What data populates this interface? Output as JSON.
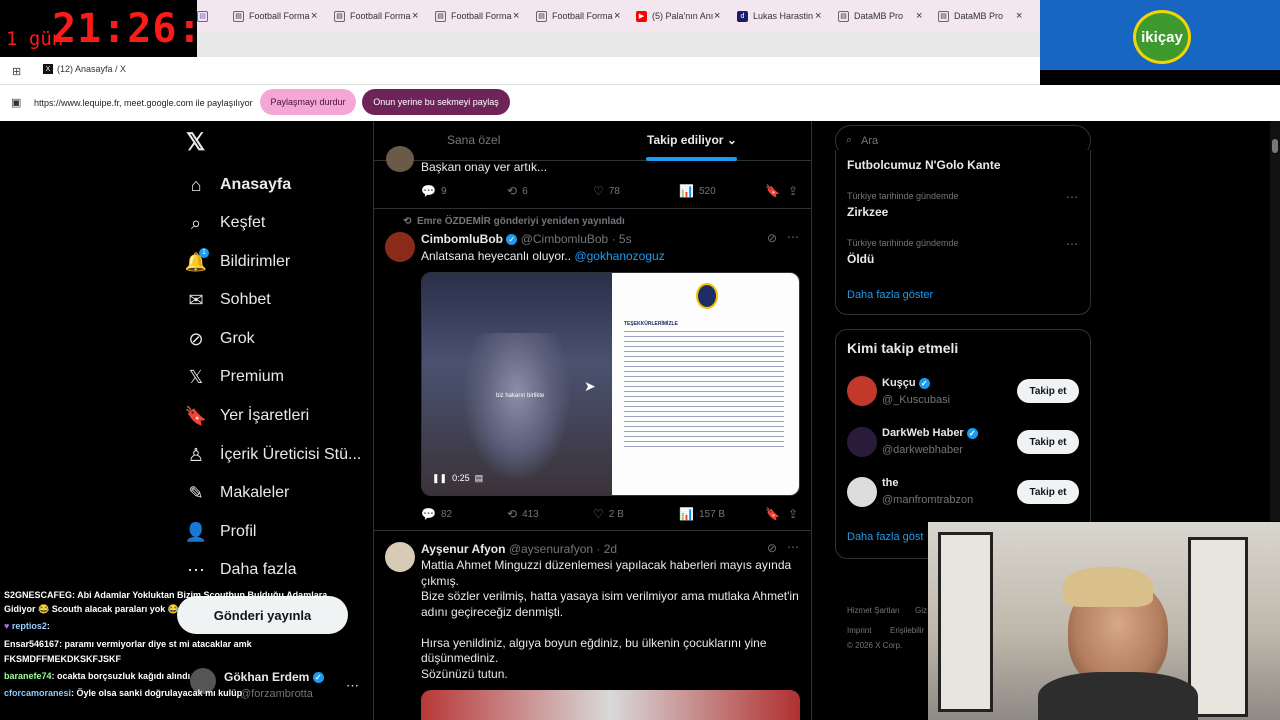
{
  "overlay": {
    "timer_day": "1 gün",
    "timer_clock": "21:26:55",
    "sponsor": "ikiçay"
  },
  "browser": {
    "tabs": [
      {
        "label": "Football Forma",
        "icon": "doc-icon"
      },
      {
        "label": "Football Forma",
        "icon": "doc-icon"
      },
      {
        "label": "Football Forma",
        "icon": "doc-icon"
      },
      {
        "label": "Football Forma",
        "icon": "doc-icon"
      },
      {
        "label": "(5) Pala'nın Anı",
        "icon": "youtube-icon"
      },
      {
        "label": "Lukas Harastin",
        "icon": "dm-icon"
      },
      {
        "label": "DataMB Pro",
        "icon": "doc-icon"
      },
      {
        "label": "DataMB Pro",
        "icon": "doc-icon"
      }
    ],
    "active_tab": "(12) Anasayfa / X",
    "share_message": "https://www.lequipe.fr, meet.google.com ile paylaşılıyor",
    "stop_sharing": "Paylaşmayı durdur",
    "share_this_tab": "Onun yerine bu sekmeyi paylaş"
  },
  "nav": {
    "logo": "𝕏",
    "items": [
      {
        "label": "Anasayfa",
        "icon": "home-icon",
        "glyph": "⌂"
      },
      {
        "label": "Keşfet",
        "icon": "search-icon",
        "glyph": "⌕"
      },
      {
        "label": "Bildirimler",
        "icon": "bell-icon",
        "glyph": "🔔"
      },
      {
        "label": "Sohbet",
        "icon": "mail-icon",
        "glyph": "✉"
      },
      {
        "label": "Grok",
        "icon": "grok-icon",
        "glyph": "⊘"
      },
      {
        "label": "Premium",
        "icon": "x-premium-icon",
        "glyph": "𝕏"
      },
      {
        "label": "Yer İşaretleri",
        "icon": "bookmark-icon",
        "glyph": "🔖"
      },
      {
        "label": "İçerik Üreticisi Stü...",
        "icon": "creator-icon",
        "glyph": "♙"
      },
      {
        "label": "Makaleler",
        "icon": "article-icon",
        "glyph": "✎"
      },
      {
        "label": "Profil",
        "icon": "profile-icon",
        "glyph": "👤"
      },
      {
        "label": "Daha fazla",
        "icon": "more-circle-icon",
        "glyph": "⋯"
      }
    ],
    "notif_badge": "1",
    "post_button": "Gönderi yayınla",
    "account_name": "Gökhan Erdem",
    "account_handle": "@forzambrotta"
  },
  "timeline": {
    "tab_for_you": "Sana özel",
    "tab_following": "Takip ediliyor",
    "post1": {
      "text": "Başkan onay ver artık...",
      "replies": "9",
      "reposts": "6",
      "likes": "78",
      "views": "520"
    },
    "post2": {
      "repost_by": "Emre ÖZDEMİR gönderiyi yeniden yayınladı",
      "name": "CimbomluBob",
      "handle": "@CimbomluBob",
      "time": "· 5s",
      "text": "Anlatsana heyecanlı oluyor..",
      "mention": "@gokhanozoguz",
      "video_time": "0:25",
      "caption": "biz hakarın birlikte",
      "doc_title": "TEŞEKKÜRLERİMİZLE",
      "replies": "82",
      "reposts": "413",
      "likes": "2 B",
      "views": "157 B"
    },
    "post3": {
      "name": "Ayşenur Afyon",
      "handle": "@aysenurafyon",
      "time": "· 2d",
      "lines": [
        "Mattia Ahmet Minguzzi düzenlemesi yapılacak haberleri mayıs ayında",
        "çıkmış.",
        "Bize sözler verilmiş, hatta yasaya isim verilmiyor ama mutlaka Ahmet'in",
        "adını geçireceğiz denmişti.",
        "",
        "Hırsa yenildiniz, algıya boyun eğdiniz, bu ülkenin çocuklarını yine",
        "düşünmediniz.",
        "Sözünüzü tutun."
      ]
    }
  },
  "right": {
    "search_placeholder": "Ara",
    "trend_top": "Futbolcumuz N'Golo Kante",
    "trends": [
      {
        "context": "Türkiye tarihinde gündemde",
        "name": "Zirkzee"
      },
      {
        "context": "Türkiye tarihinde gündemde",
        "name": "Öldü"
      }
    ],
    "show_more": "Daha fazla göster",
    "who_to_follow": "Kimi takip etmeli",
    "suggestions": [
      {
        "name": "Kuşçu",
        "handle": "@_Kuscubasi",
        "verified": true
      },
      {
        "name": "DarkWeb Haber",
        "handle": "@darkwebhaber",
        "verified": true
      },
      {
        "name": "the",
        "handle": "@manfromtrabzon",
        "verified": false
      }
    ],
    "follow_label": "Takip et",
    "show_more2": "Daha fazla göst",
    "footer": [
      "Hizmet Şartları",
      "Giz",
      "Imprint",
      "Erişilebilir",
      "© 2026 X Corp."
    ]
  },
  "chat": [
    {
      "user": "S2GNESCAFEG",
      "msg": ": Abi Adamlar Yokluktan Bizim Scouthun Bulduğu Adamlara"
    },
    {
      "user": "",
      "msg": "Gidiyor 😂 Scouth alacak paraları yok 😂"
    },
    {
      "user": "reptios2",
      "msg": ":"
    },
    {
      "user": "Ensar546167",
      "msg": ": paramı vermiyorlar diye st mi atacaklar amk"
    },
    {
      "user": "",
      "msg": "FKSMDFFMEKDKSKFJSKF"
    },
    {
      "user": "baranefe74",
      "msg": ": ocakta borçsuzluk kağıdı alındı"
    },
    {
      "user": "cforcamoranesi",
      "msg": ": Öyle olsa sanki doğrulayacak mı kulüp"
    }
  ],
  "colors": {
    "accent": "#1d9bf0",
    "share_pink": "#f4a6d6",
    "share_purple": "#6e2458",
    "sponsor_blue": "#1766c2"
  }
}
